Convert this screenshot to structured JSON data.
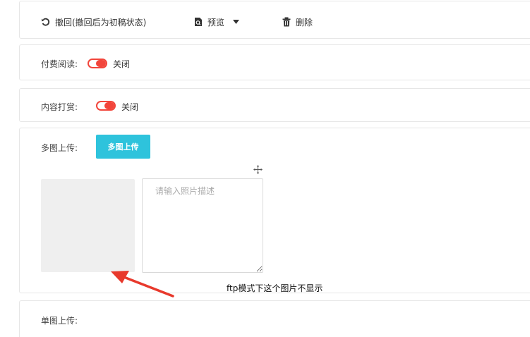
{
  "toolbar": {
    "undo_label": "撤回(撤回后为初稿状态)",
    "preview_label": "预览",
    "delete_label": "删除"
  },
  "paid_read": {
    "label": "付费阅读:",
    "state": "关闭"
  },
  "reward": {
    "label": "内容打赏:",
    "state": "关闭"
  },
  "multi_upload": {
    "label": "多图上传:",
    "button_label": "多图上传",
    "description_placeholder": "请输入照片描述"
  },
  "single_upload": {
    "label": "单图上传:"
  },
  "annotation": {
    "note": "ftp模式下这个图片不显示"
  },
  "colors": {
    "toggle_off": "#f2453b",
    "upload_button": "#2ec3dc",
    "arrow": "#e8392c"
  }
}
